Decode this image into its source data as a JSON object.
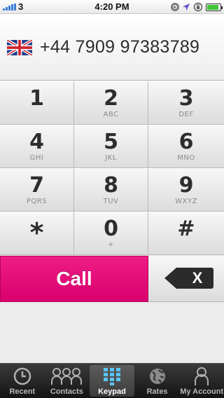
{
  "status_bar": {
    "carrier": "3",
    "time": "4:20 PM",
    "battery_level": 0.9,
    "icons": [
      "signal-bars-icon",
      "alarm-icon",
      "location-arrow-icon",
      "rotation-lock-icon",
      "battery-icon"
    ]
  },
  "display": {
    "flag_icon": "uk-flag-icon",
    "number": "+44 7909 97383789"
  },
  "keypad": {
    "keys": [
      {
        "digit": "1",
        "letters": ""
      },
      {
        "digit": "2",
        "letters": "ABC"
      },
      {
        "digit": "3",
        "letters": "DEF"
      },
      {
        "digit": "4",
        "letters": "GHI"
      },
      {
        "digit": "5",
        "letters": "JKL"
      },
      {
        "digit": "6",
        "letters": "MNO"
      },
      {
        "digit": "7",
        "letters": "PQRS"
      },
      {
        "digit": "8",
        "letters": "TUV"
      },
      {
        "digit": "9",
        "letters": "WXYZ"
      },
      {
        "digit": "*",
        "letters": ""
      },
      {
        "digit": "0",
        "letters": "+"
      },
      {
        "digit": "#",
        "letters": ""
      }
    ]
  },
  "actions": {
    "call_label": "Call",
    "backspace_label": "X"
  },
  "tab_bar": {
    "active": "Keypad",
    "tabs": [
      {
        "label": "Recent",
        "icon": "clock-icon"
      },
      {
        "label": "Contacts",
        "icon": "contacts-icon"
      },
      {
        "label": "Keypad",
        "icon": "keypad-icon"
      },
      {
        "label": "Rates",
        "icon": "globe-icon"
      },
      {
        "label": "My Account",
        "icon": "account-icon"
      }
    ]
  },
  "colors": {
    "call_button": "#e8137d",
    "tab_bar": "#1f1f1f",
    "signal_bars": "#3b7fd6",
    "battery_fill": "#3fc536"
  }
}
